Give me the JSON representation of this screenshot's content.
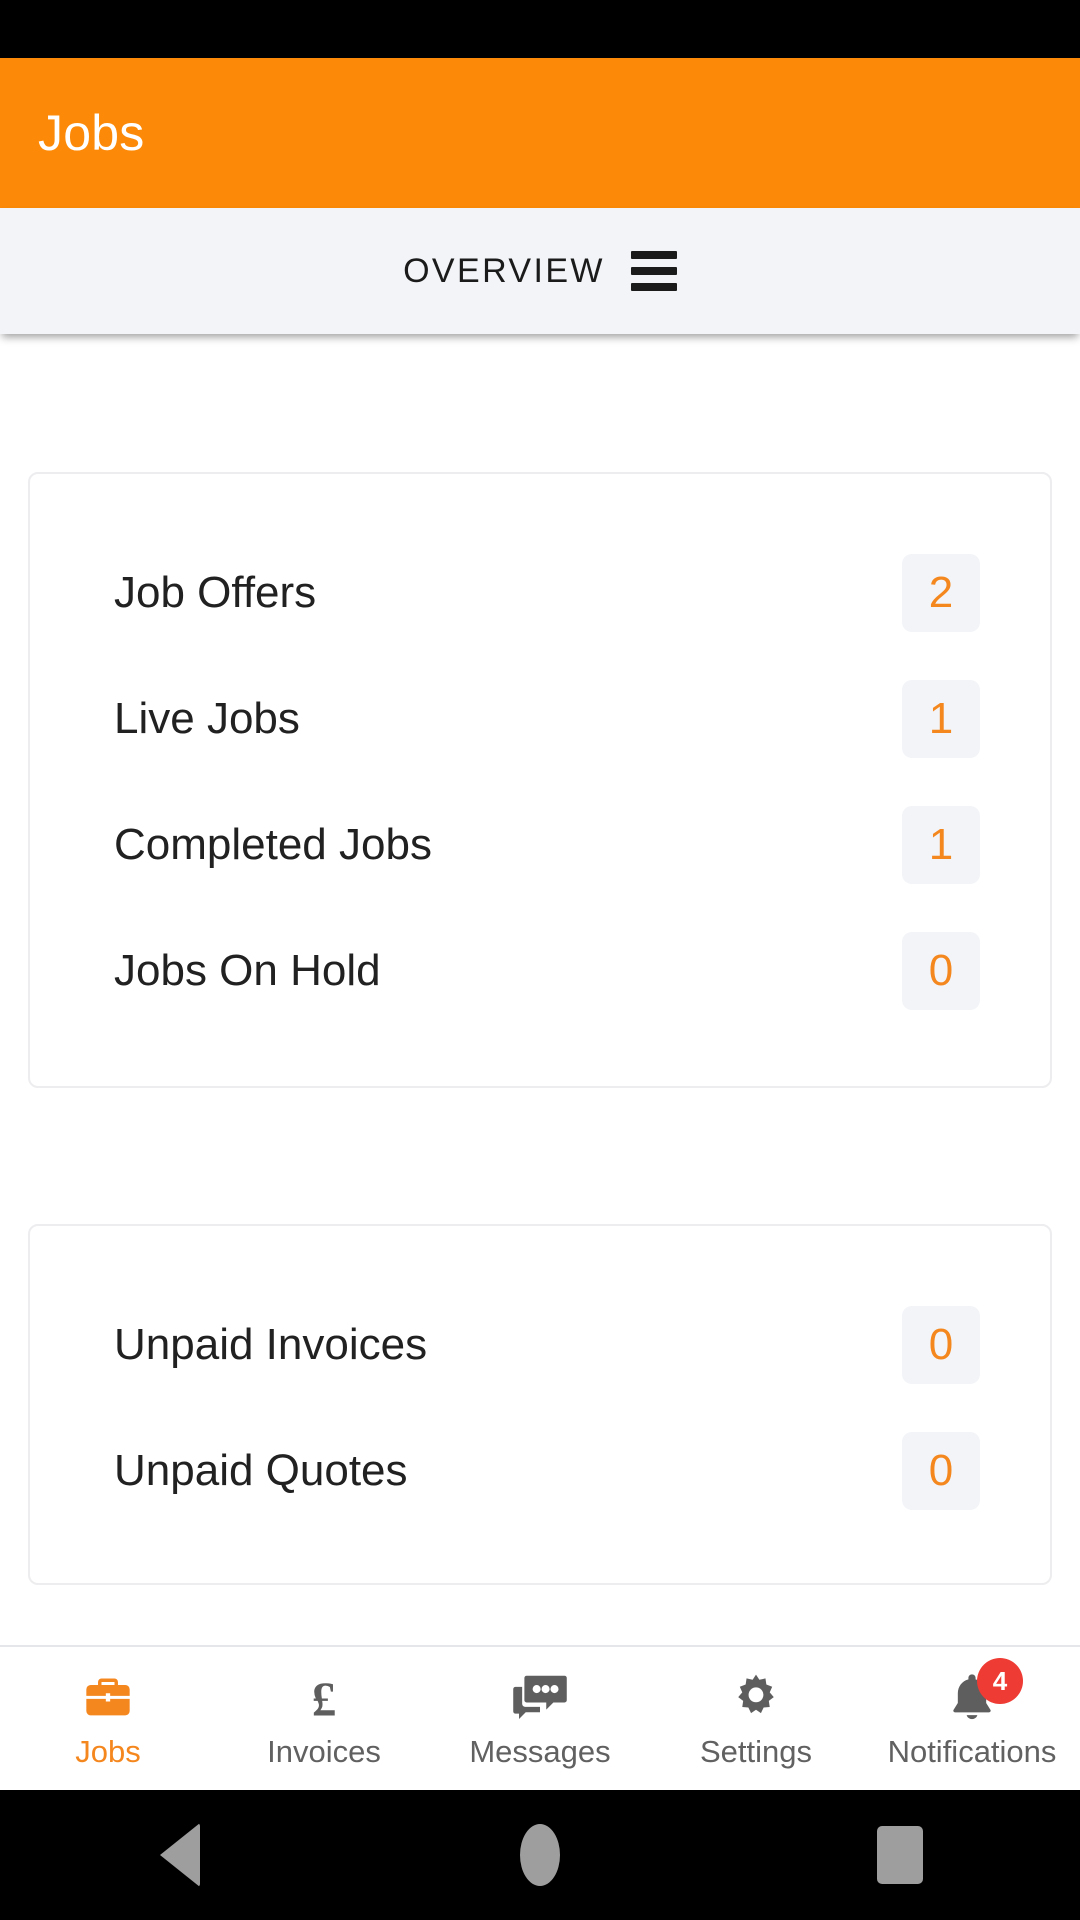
{
  "theme": {
    "accent": "#fc8a08",
    "accent_text": "#f5871f",
    "badge_bg": "#f2f4f7",
    "notification_badge": "#ee3b33",
    "header_text": "#ffffff",
    "body_text": "#212121",
    "nav_inactive": "#616161"
  },
  "app_bar": {
    "title": "Jobs"
  },
  "tab_bar": {
    "label": "OVERVIEW",
    "menu_icon": "hamburger-icon"
  },
  "cards": [
    {
      "id": "jobs-summary",
      "rows": [
        {
          "label": "Job Offers",
          "value": "2"
        },
        {
          "label": "Live Jobs",
          "value": "1"
        },
        {
          "label": "Completed Jobs",
          "value": "1"
        },
        {
          "label": "Jobs On Hold",
          "value": "0"
        }
      ]
    },
    {
      "id": "billing-summary",
      "rows": [
        {
          "label": "Unpaid Invoices",
          "value": "0"
        },
        {
          "label": "Unpaid Quotes",
          "value": "0"
        }
      ]
    }
  ],
  "bottom_nav": {
    "items": [
      {
        "label": "Jobs",
        "icon": "briefcase-icon",
        "active": true,
        "badge": ""
      },
      {
        "label": "Invoices",
        "icon": "pound-icon",
        "active": false,
        "badge": ""
      },
      {
        "label": "Messages",
        "icon": "chat-icon",
        "active": false,
        "badge": ""
      },
      {
        "label": "Settings",
        "icon": "gear-icon",
        "active": false,
        "badge": ""
      },
      {
        "label": "Notifications",
        "icon": "bell-icon",
        "active": false,
        "badge": "4"
      }
    ]
  },
  "system_nav": {
    "back": "back-triangle-icon",
    "home": "home-circle-icon",
    "recents": "recents-square-icon"
  }
}
